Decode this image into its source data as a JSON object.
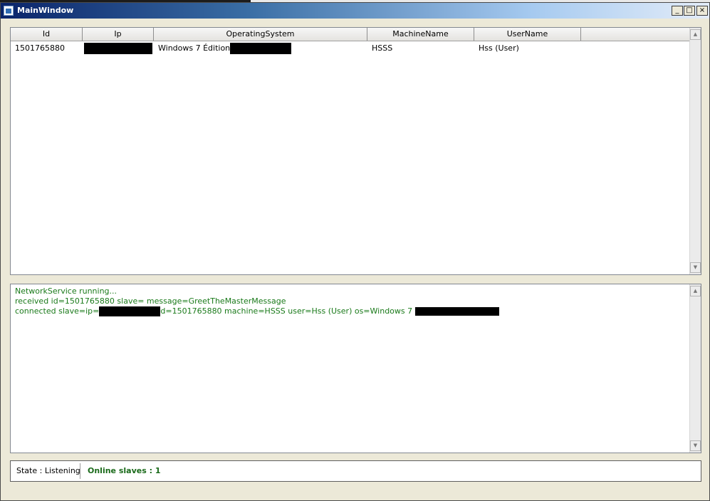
{
  "window": {
    "title": "MainWindow"
  },
  "title_buttons": {
    "minimize": "_",
    "maximize": "□",
    "close": "×"
  },
  "grid": {
    "columns": [
      "Id",
      "Ip",
      "OperatingSystem",
      "MachineName",
      "UserName"
    ],
    "rows": [
      {
        "id": "1501765880",
        "ip": "",
        "os": "Windows 7 Édition",
        "machine": "HSSS",
        "user": "Hss (User)"
      }
    ]
  },
  "log": {
    "lines": [
      "NetworkService running...",
      "received id=1501765880 slave= message=GreetTheMasterMessage"
    ],
    "line3_prefix": "connected slave=ip=",
    "line3_middle": "d=1501765880 machine=HSSS user=Hss (User) os=Windows 7 "
  },
  "status": {
    "state": "State : Listening",
    "online": "Online slaves : 1"
  },
  "colors": {
    "log_text": "#1a7a1a",
    "online_text": "#1a6a1a",
    "redaction": "#000000"
  }
}
